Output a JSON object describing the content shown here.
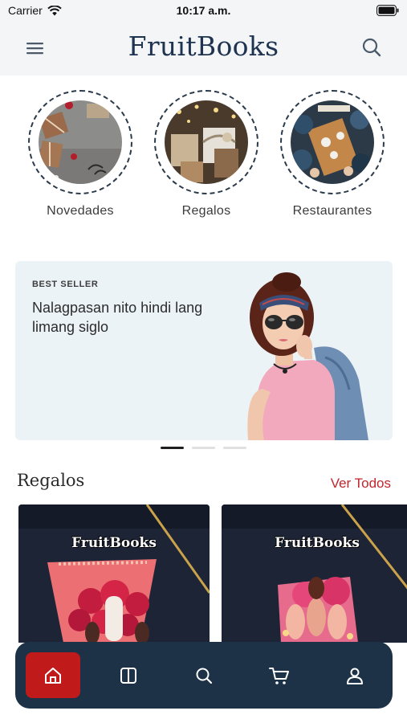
{
  "status_bar": {
    "carrier": "Carrier",
    "time": "10:17 a.m."
  },
  "header": {
    "brand": "FruitBooks",
    "menu_icon": "hamburger-menu-icon",
    "search_icon": "search-icon"
  },
  "categories": [
    {
      "label": "Novedades"
    },
    {
      "label": "Regalos"
    },
    {
      "label": "Restaurantes"
    }
  ],
  "banner": {
    "eyebrow": "BEST SELLER",
    "title": "Nalagpasan nito hindi lang limang siglo",
    "slide_count": 3,
    "active_slide": 1
  },
  "section": {
    "title": "Regalos",
    "link": "Ver Todos"
  },
  "products": [
    {
      "logo_text": "FruitBooks"
    },
    {
      "logo_text": "FruitBooks"
    }
  ],
  "bottom_nav": {
    "items": [
      "home-icon",
      "catalog-icon",
      "search-icon",
      "cart-icon",
      "profile-icon"
    ],
    "active": "home-icon"
  },
  "colors": {
    "brand_navy": "#1e3350",
    "nav_background": "#1d3247",
    "accent_red": "#c11a1a",
    "link_red": "#c0262d",
    "banner_background": "#ecf3f7"
  }
}
